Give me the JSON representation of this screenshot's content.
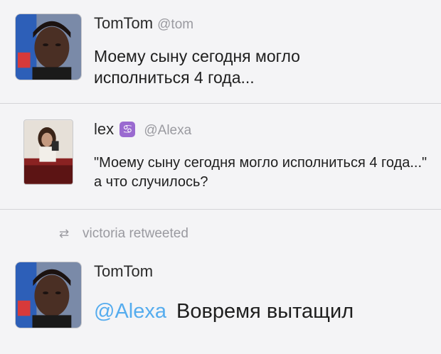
{
  "tweets": [
    {
      "name": "TomTom",
      "handle": "@tom",
      "text": "Моему сыну сегодня могло исполниться 4 года..."
    },
    {
      "name": "lex",
      "zodiac_icon": "♋",
      "handle": "@Alexa",
      "text": "\"Моему сыну сегодня могло исполниться 4 года...\" а что случилось?"
    },
    {
      "retweet_label": "victoria retweeted",
      "retweet_icon": "⇄",
      "name": "TomTom",
      "mention": "@Alexa",
      "text": "Вовремя вытащил"
    }
  ],
  "colors": {
    "mention": "#55acee",
    "handle": "#9a9aa0",
    "zodiac_badge": "#9a6ad0"
  }
}
